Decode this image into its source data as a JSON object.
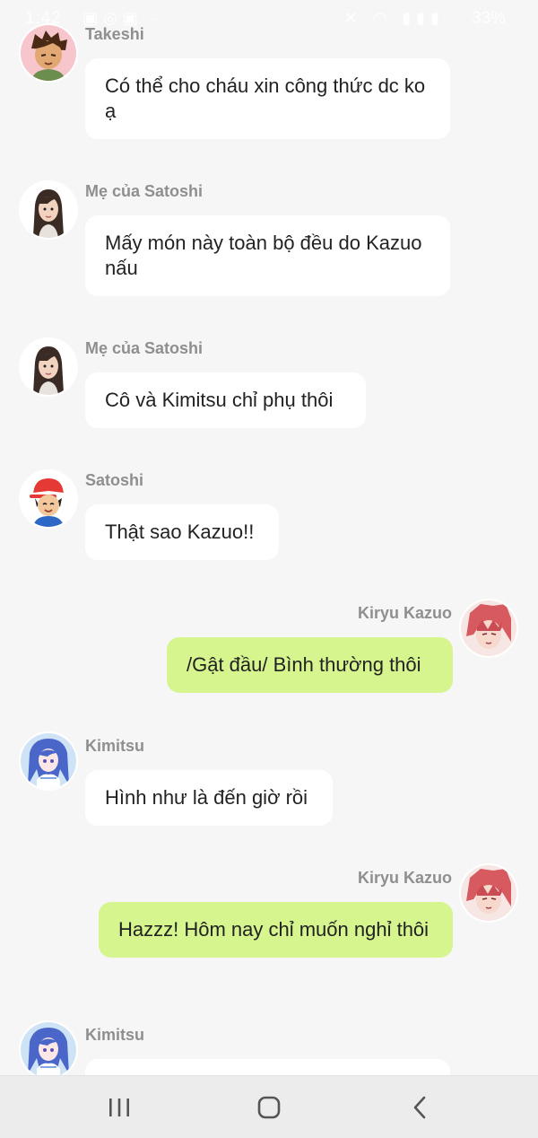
{
  "status_bar": {
    "time": "1:42",
    "battery": "33%"
  },
  "messages": [
    {
      "sender": "Takeshi",
      "text": "Có thể cho cháu xin công thức dc ko ạ",
      "avatar": "takeshi-avatar"
    },
    {
      "sender": "Mẹ của Satoshi",
      "text": "Mấy món này toàn bộ đều do Kazuo nấu",
      "avatar": "satoshi-mom-avatar"
    },
    {
      "sender": "Mẹ của Satoshi",
      "text": "Cô và Kimitsu chỉ phụ thôi",
      "avatar": "satoshi-mom-avatar"
    },
    {
      "sender": "Satoshi",
      "text": "Thật sao Kazuo!!",
      "avatar": "satoshi-avatar"
    },
    {
      "sender": "Kiryu Kazuo",
      "text": "/Gật đầu/ Bình thường thôi",
      "avatar": "kazuo-avatar"
    },
    {
      "sender": "Kimitsu",
      "text": "Hình như là đến giờ rồi",
      "avatar": "kimitsu-avatar"
    },
    {
      "sender": "Kiryu Kazuo",
      "text": "Hazzz! Hôm nay chỉ muốn nghỉ thôi",
      "avatar": "kazuo-avatar"
    },
    {
      "sender": "Kimitsu",
      "text": "",
      "avatar": "kimitsu-avatar"
    }
  ],
  "colors": {
    "background": "#f6f6f6",
    "incoming_bubble": "#ffffff",
    "outgoing_bubble": "#d6f58e",
    "sender_name": "#8f8f8f",
    "nav_bar": "#ececec"
  },
  "nav_bar": {
    "recents_icon": "recents-icon",
    "home_icon": "home-icon",
    "back_icon": "back-icon"
  }
}
